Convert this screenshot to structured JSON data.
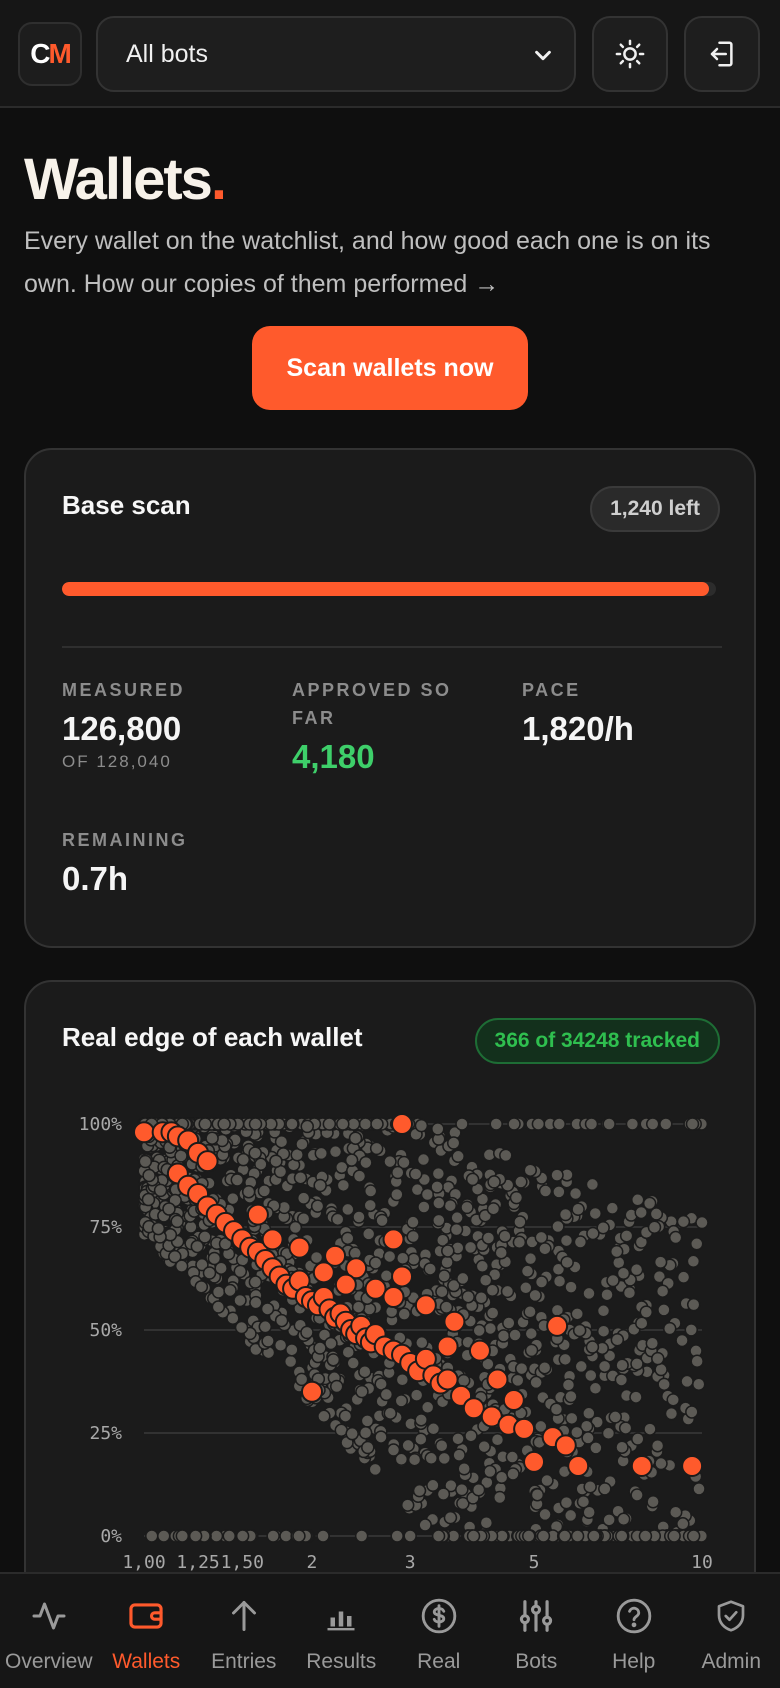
{
  "header": {
    "logo_c": "C",
    "logo_m": "M",
    "bot_select_value": "All bots",
    "theme_icon": "sun-icon",
    "logout_icon": "logout-icon"
  },
  "page": {
    "title": "Wallets",
    "title_dot": ".",
    "subtitle": "Every wallet on the watchlist, and how good each one is on its own. How our copies of them performed →",
    "scan_button": "Scan wallets now"
  },
  "scan_card": {
    "title": "Base scan",
    "left_badge": "1,240 left",
    "progress_fraction": 0.99,
    "measured_label": "MEASURED",
    "measured_value": "126,800",
    "measured_sub": "OF 128,040",
    "approved_label": "APPROVED SO FAR",
    "approved_value": "4,180",
    "pace_label": "PACE",
    "pace_value": "1,820/h",
    "remaining_label": "REMAINING",
    "remaining_value": "0.7h"
  },
  "edge_card": {
    "title": "Real edge of each wallet",
    "tracked_badge": "366 of 34248 tracked"
  },
  "chart_data": {
    "type": "scatter",
    "title": "Real edge of each wallet",
    "xscale": "log",
    "xlim": [
      1,
      10
    ],
    "ylim": [
      0,
      100
    ],
    "x_ticks": [
      "1,00",
      "1,25",
      "1,50",
      "2",
      "3",
      "5",
      "10"
    ],
    "x_tick_values": [
      1.0,
      1.25,
      1.5,
      2,
      3,
      5,
      10
    ],
    "y_ticks": [
      "0%",
      "25%",
      "50%",
      "75%",
      "100%"
    ],
    "y_tick_values": [
      0,
      25,
      50,
      75,
      100
    ],
    "grid": true,
    "colors": {
      "untracked": "#5c5a55",
      "tracked": "#ff5a2c"
    },
    "series": [
      {
        "role": "tracked",
        "points": [
          [
            1.0,
            98
          ],
          [
            1.08,
            98
          ],
          [
            1.12,
            98
          ],
          [
            1.15,
            97
          ],
          [
            1.2,
            96
          ],
          [
            1.25,
            93
          ],
          [
            1.3,
            91
          ],
          [
            1.15,
            88
          ],
          [
            1.2,
            85
          ],
          [
            1.25,
            83
          ],
          [
            1.3,
            80
          ],
          [
            1.35,
            78
          ],
          [
            1.4,
            76
          ],
          [
            1.45,
            74
          ],
          [
            1.5,
            72
          ],
          [
            1.55,
            70
          ],
          [
            1.6,
            69
          ],
          [
            1.65,
            67
          ],
          [
            1.7,
            65
          ],
          [
            1.75,
            63
          ],
          [
            1.8,
            61
          ],
          [
            1.85,
            60
          ],
          [
            1.9,
            62
          ],
          [
            1.95,
            58
          ],
          [
            2.0,
            57
          ],
          [
            2.05,
            56
          ],
          [
            2.1,
            58
          ],
          [
            2.15,
            55
          ],
          [
            2.2,
            53
          ],
          [
            2.25,
            54
          ],
          [
            2.3,
            52
          ],
          [
            2.35,
            50
          ],
          [
            2.4,
            49
          ],
          [
            2.45,
            51
          ],
          [
            2.5,
            48
          ],
          [
            2.55,
            47
          ],
          [
            2.6,
            49
          ],
          [
            2.7,
            46
          ],
          [
            2.8,
            45
          ],
          [
            2.9,
            44
          ],
          [
            3.0,
            42
          ],
          [
            3.1,
            40
          ],
          [
            3.2,
            43
          ],
          [
            3.3,
            39
          ],
          [
            3.4,
            37
          ],
          [
            3.5,
            38
          ],
          [
            3.7,
            34
          ],
          [
            3.9,
            31
          ],
          [
            4.2,
            29
          ],
          [
            4.5,
            27
          ],
          [
            4.8,
            26
          ],
          [
            5.0,
            18
          ],
          [
            5.4,
            24
          ],
          [
            5.7,
            22
          ],
          [
            6.0,
            17
          ],
          [
            7.8,
            17
          ],
          [
            9.6,
            17
          ],
          [
            2.2,
            68
          ],
          [
            1.6,
            78
          ],
          [
            1.7,
            72
          ],
          [
            2.4,
            65
          ],
          [
            2.6,
            60
          ],
          [
            2.8,
            58
          ],
          [
            2.9,
            63
          ],
          [
            1.9,
            70
          ],
          [
            2.1,
            64
          ],
          [
            2.3,
            61
          ],
          [
            3.2,
            56
          ],
          [
            3.5,
            46
          ],
          [
            3.6,
            52
          ],
          [
            4.0,
            45
          ],
          [
            4.3,
            38
          ],
          [
            4.6,
            33
          ],
          [
            5.5,
            51
          ],
          [
            2.8,
            72
          ],
          [
            2.0,
            35
          ],
          [
            2.9,
            100
          ]
        ]
      }
    ]
  },
  "bottom_nav": [
    {
      "label": "Overview",
      "icon": "activity-icon",
      "active": false
    },
    {
      "label": "Wallets",
      "icon": "wallet-icon",
      "active": true
    },
    {
      "label": "Entries",
      "icon": "arrow-up-icon",
      "active": false
    },
    {
      "label": "Results",
      "icon": "bar-chart-icon",
      "active": false
    },
    {
      "label": "Real",
      "icon": "dollar-circle-icon",
      "active": false
    },
    {
      "label": "Bots",
      "icon": "sliders-icon",
      "active": false
    },
    {
      "label": "Help",
      "icon": "help-circle-icon",
      "active": false
    },
    {
      "label": "Admin",
      "icon": "shield-check-icon",
      "active": false
    }
  ]
}
